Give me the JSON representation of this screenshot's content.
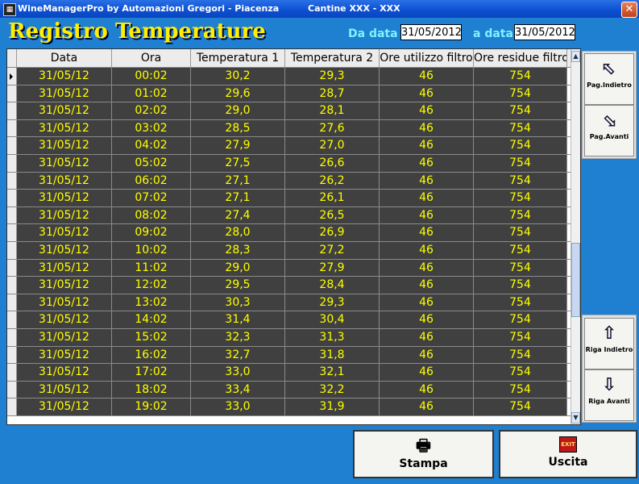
{
  "window": {
    "title": "WineManagerPro by Automazioni Gregori - Piacenza",
    "subtitle": "Cantine XXX - XXX"
  },
  "header": {
    "page_title": "Registro Temperature",
    "from_label": "Da data",
    "from_value": "31/05/2012",
    "to_label": "a data",
    "to_value": "31/05/2012"
  },
  "table": {
    "columns": [
      "Data",
      "Ora",
      "Temperatura 1",
      "Temperatura 2",
      "Ore utilizzo filtro",
      "Ore residue filtro"
    ],
    "rows": [
      [
        "31/05/12",
        "00:02",
        "30,2",
        "29,3",
        "46",
        "754"
      ],
      [
        "31/05/12",
        "01:02",
        "29,6",
        "28,7",
        "46",
        "754"
      ],
      [
        "31/05/12",
        "02:02",
        "29,0",
        "28,1",
        "46",
        "754"
      ],
      [
        "31/05/12",
        "03:02",
        "28,5",
        "27,6",
        "46",
        "754"
      ],
      [
        "31/05/12",
        "04:02",
        "27,9",
        "27,0",
        "46",
        "754"
      ],
      [
        "31/05/12",
        "05:02",
        "27,5",
        "26,6",
        "46",
        "754"
      ],
      [
        "31/05/12",
        "06:02",
        "27,1",
        "26,2",
        "46",
        "754"
      ],
      [
        "31/05/12",
        "07:02",
        "27,1",
        "26,1",
        "46",
        "754"
      ],
      [
        "31/05/12",
        "08:02",
        "27,4",
        "26,5",
        "46",
        "754"
      ],
      [
        "31/05/12",
        "09:02",
        "28,0",
        "26,9",
        "46",
        "754"
      ],
      [
        "31/05/12",
        "10:02",
        "28,3",
        "27,2",
        "46",
        "754"
      ],
      [
        "31/05/12",
        "11:02",
        "29,0",
        "27,9",
        "46",
        "754"
      ],
      [
        "31/05/12",
        "12:02",
        "29,5",
        "28,4",
        "46",
        "754"
      ],
      [
        "31/05/12",
        "13:02",
        "30,3",
        "29,3",
        "46",
        "754"
      ],
      [
        "31/05/12",
        "14:02",
        "31,4",
        "30,4",
        "46",
        "754"
      ],
      [
        "31/05/12",
        "15:02",
        "32,3",
        "31,3",
        "46",
        "754"
      ],
      [
        "31/05/12",
        "16:02",
        "32,7",
        "31,8",
        "46",
        "754"
      ],
      [
        "31/05/12",
        "17:02",
        "33,0",
        "32,1",
        "46",
        "754"
      ],
      [
        "31/05/12",
        "18:02",
        "33,4",
        "32,2",
        "46",
        "754"
      ],
      [
        "31/05/12",
        "19:02",
        "33,0",
        "31,9",
        "46",
        "754"
      ]
    ]
  },
  "side_buttons": {
    "page_back": "Pag.Indietro",
    "page_forward": "Pag.Avanti",
    "row_back": "Riga Indietro",
    "row_forward": "Riga Avanti"
  },
  "bottom_buttons": {
    "print": "Stampa",
    "exit": "Uscita",
    "exit_icon_text": "EXIT"
  },
  "colors": {
    "background": "#1f7fd0",
    "title_yellow": "#ffee00",
    "label_cyan": "#7ff2ff",
    "cell_bg": "#404040",
    "cell_text": "#ffff00"
  }
}
